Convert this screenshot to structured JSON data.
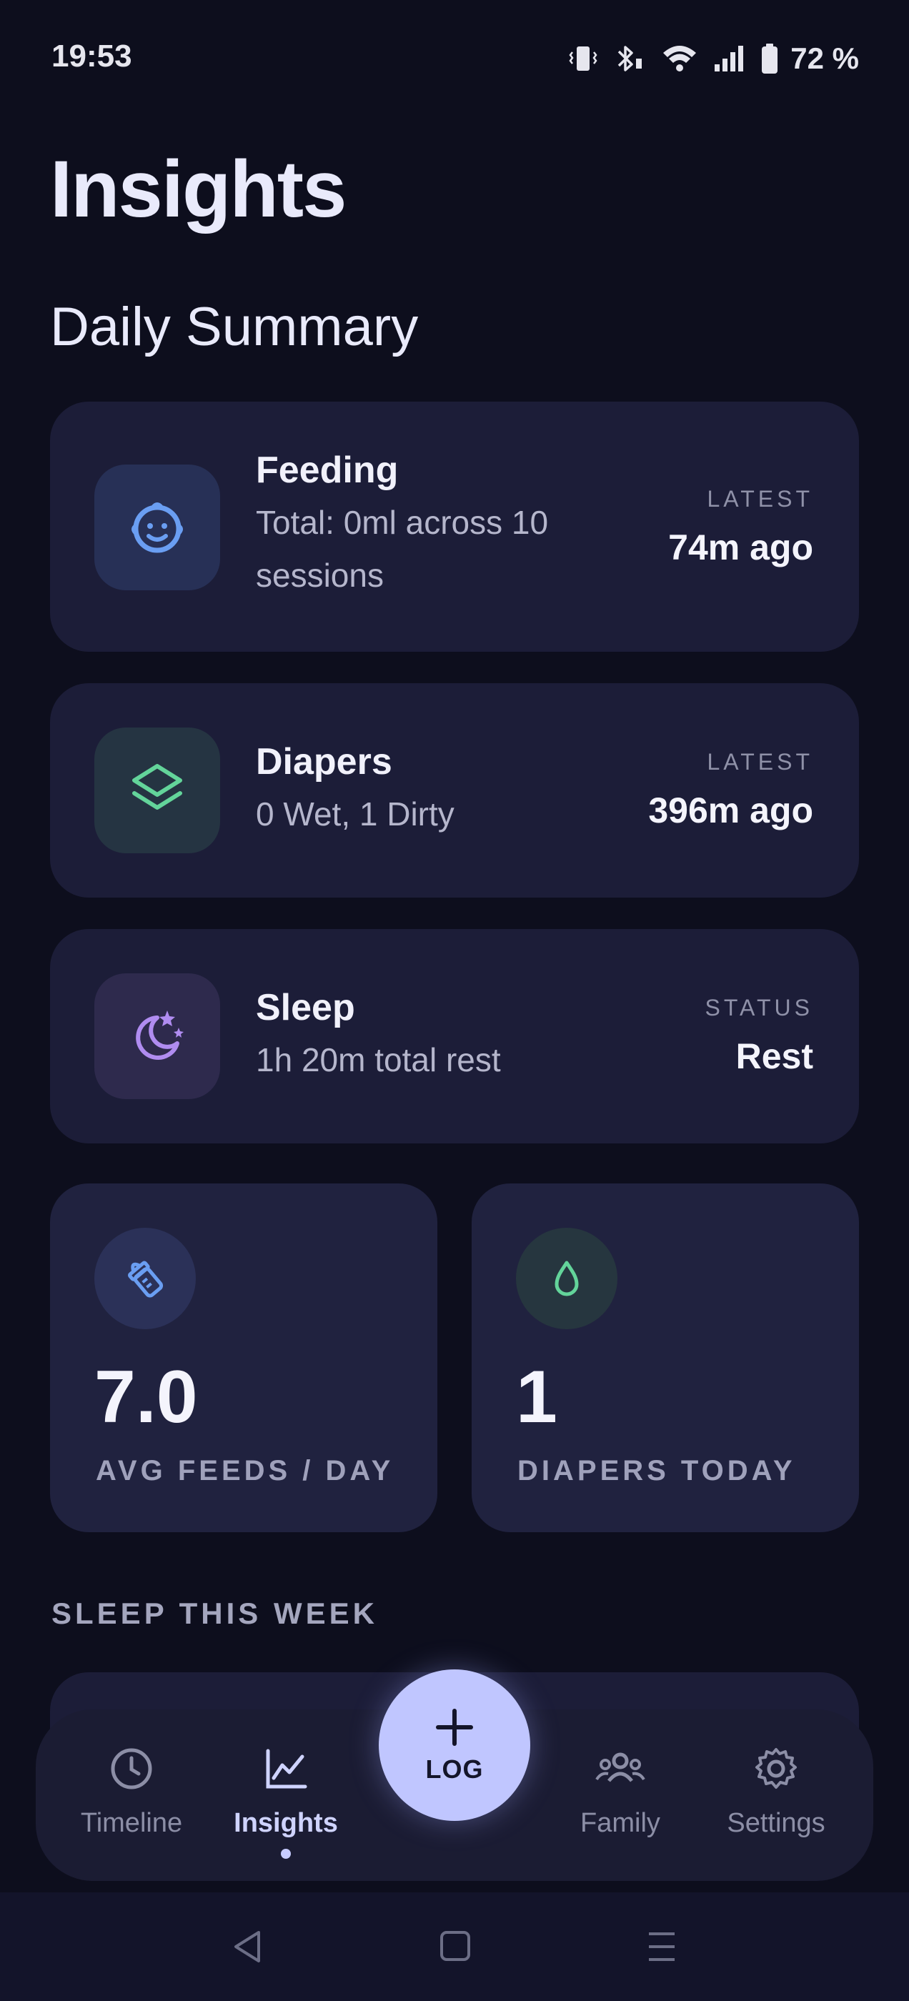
{
  "status_bar": {
    "time": "19:53",
    "battery": "72 %",
    "icons": [
      "vibrate-icon",
      "bluetooth-icon",
      "wifi-icon",
      "signal-icon",
      "battery-icon"
    ]
  },
  "page": {
    "title": "Insights",
    "section_title": "Daily Summary"
  },
  "summary_cards": [
    {
      "icon": "baby-face-icon",
      "name": "Feeding",
      "desc_line1": "Total: 0ml across 10",
      "desc_line2": "sessions",
      "right_label": "LATEST",
      "right_value": "74m ago",
      "accent": "#5b8de8"
    },
    {
      "icon": "layers-icon",
      "name": "Diapers",
      "desc_line1": "0 Wet, 1 Dirty",
      "right_label": "LATEST",
      "right_value": "396m ago",
      "accent": "#63d49a"
    },
    {
      "icon": "moon-stars-icon",
      "name": "Sleep",
      "desc_line1": "1h 20m total rest",
      "right_label": "STATUS",
      "right_value": "Rest",
      "accent": "#b08cf0"
    }
  ],
  "stats": [
    {
      "icon": "bottle-icon",
      "value": "7.0",
      "label": "AVG FEEDS / DAY",
      "accent": "#5b8de8"
    },
    {
      "icon": "drop-icon",
      "value": "1",
      "label": "DIAPERS TODAY",
      "accent": "#63d49a"
    }
  ],
  "week_section": {
    "title": "SLEEP THIS WEEK"
  },
  "bottom_nav": {
    "items": [
      {
        "icon": "clock-icon",
        "label": "Timeline"
      },
      {
        "icon": "chart-icon",
        "label": "Insights",
        "active": true
      },
      {
        "icon": "users-icon",
        "label": "Family"
      },
      {
        "icon": "gear-icon",
        "label": "Settings"
      }
    ],
    "fab_label": "LOG"
  },
  "system_nav": [
    "back-icon",
    "home-icon",
    "menu-icon"
  ]
}
